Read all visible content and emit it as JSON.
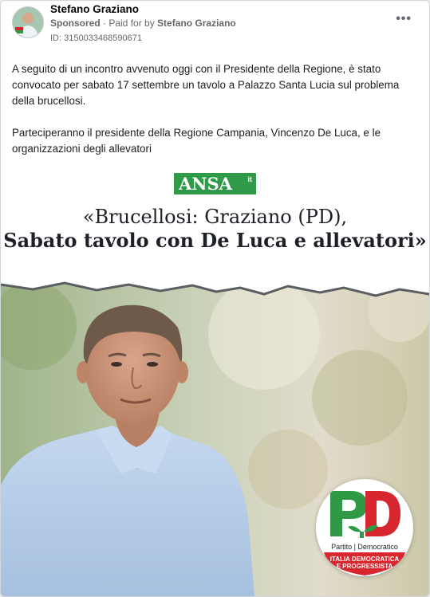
{
  "post": {
    "author": "Stefano Graziano",
    "sponsored_label": "Sponsored",
    "paid_for_label": " · Paid for by ",
    "paid_for_name": "Stefano Graziano",
    "ad_id": "ID: 3150033468590671",
    "more_icon": "more-options-icon",
    "paragraphs": [
      "A seguito di un incontro avvenuto oggi con il Presidente della Regione, è stato convocato per sabato 17 settembre un tavolo a Palazzo Santa Lucia sul problema della brucellosi.",
      "Parteciperanno il presidente della Regione Campania, Vincenzo De Luca, e le organizzazioni degli allevatori"
    ]
  },
  "creative": {
    "source_logo": "ANSA",
    "source_logo_suffix": "it",
    "headline_line1": "«Brucellosi: Graziano (PD),",
    "headline_line2": "Sabato tavolo con De Luca e allevatori»",
    "party_logo": {
      "letters": "PD",
      "name_left": "Partito",
      "name_right": "Democratico",
      "banner_line1": "ITALIA DEMOCRATICA",
      "banner_line2": "E PROGRESSISTA"
    },
    "colors": {
      "ansa_green": "#2f9b48",
      "pd_red": "#d7262d",
      "pd_green": "#2e9a46"
    }
  }
}
